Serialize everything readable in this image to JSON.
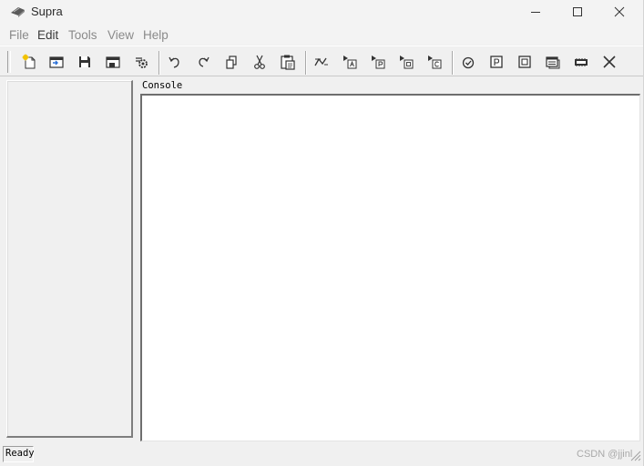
{
  "window": {
    "title": "Supra",
    "icon": "app-logo-icon",
    "controls": [
      "minimize-icon",
      "maximize-icon",
      "close-icon"
    ]
  },
  "menu": {
    "items": [
      {
        "label": "File",
        "enabled": false
      },
      {
        "label": "Edit",
        "enabled": true
      },
      {
        "label": "Tools",
        "enabled": false
      },
      {
        "label": "View",
        "enabled": false
      },
      {
        "label": "Help",
        "enabled": false
      }
    ]
  },
  "toolbar": {
    "buttons": [
      "new-file-icon",
      "open-icon",
      "save-icon",
      "save-as-icon",
      "settings-icon",
      "undo-icon",
      "redo-icon",
      "copy-icon",
      "cut-icon",
      "paste-icon",
      "compile-icon",
      "run-a-icon",
      "run-p-icon",
      "run-d-icon",
      "run-c-icon",
      "check-icon",
      "frame-p-icon",
      "frame-d-icon",
      "list-icon",
      "memory-icon",
      "stop-icon"
    ]
  },
  "console": {
    "label": "Console",
    "content": ""
  },
  "statusbar": {
    "status": "Ready",
    "watermark": "CSDN @jjinl"
  },
  "colors": {
    "window_bg": "#f0f0f0",
    "titlebar_bg": "#f3f3f3",
    "console_bg": "#ffffff",
    "icon_dark": "#3c3c3c",
    "icon_highlight": "#f2c200",
    "icon_blue": "#2a6fd6"
  }
}
